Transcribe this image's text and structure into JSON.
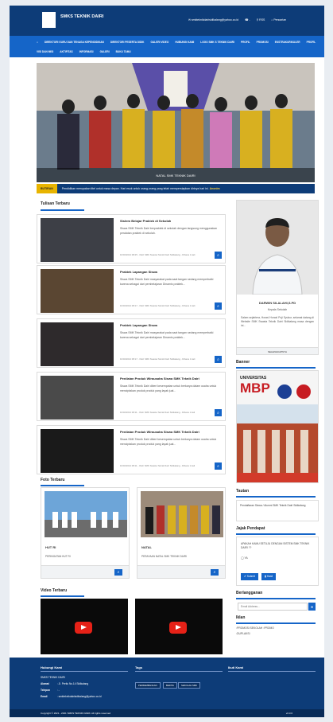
{
  "header": {
    "brand": "SMKS TEKNIK DAIRI",
    "email": "smkteknikdairisidikalang@yahoo.co.id",
    "phone": "-",
    "rss": "RSS",
    "search": "Pencarian"
  },
  "menu": [
    "BERANDA",
    "DIREKTORI GURU DAN TENAGA KEPENDIDIKAN",
    "DIREKTORI PESERTA DIDIK",
    "GALERI VIDEO",
    "HUBUNGI KAMI",
    "LOGO SMK S TEKNIK DAIRI",
    "PROFIL",
    "PROMOSI",
    "EKSTRAKURIKULER",
    "PROFIL",
    "VISI DAN MISI",
    "AKTIFITAS",
    "INFORMASI",
    "GALERI",
    "BUKU TAMU"
  ],
  "hero": {
    "caption": "NATAL SMK TEKNIK DAIRI"
  },
  "ticker": {
    "label": "BUTIRAN",
    "text": "Pendidikan merupakan titel untuk masa depan. Hari esok untuk orang-orang yang telah mempersiapkan dirinya hari ini.",
    "author": "Anonim"
  },
  "sections": {
    "posts_title": "Tulisan Terbaru",
    "photos_title": "Foto Terbaru",
    "videos_title": "Video Terbaru"
  },
  "posts": [
    {
      "title": "Sistem Belajar Praktek di Sekolah",
      "desc": "Siswa SMK Teknik Dairi berpraktek di sekolah dengan langsung menggunakan peralatan praktek di sekolah.",
      "meta": "10/02/2021 08:25 - Oleh SMK Swasta Teknik Dairi Sidikalang - Dibaca 1 kali"
    },
    {
      "title": "Praktek Lapangan Siswa",
      "desc": "Siswa SMK Teknik Dairi masyarakat pada saat tangan sedang memperbaiki karena sebagai dari pembelajaran Dinamis praktek...",
      "meta": "10/02/2021 08:17 - Oleh SMK Swasta Teknik Dairi Sidikalang - Dibaca 1 kali"
    },
    {
      "title": "Praktek Lapangan Siswa",
      "desc": "Siswa SMK Teknik Dairi masyarakat pada saat tangan sedang memperbaiki karena sebagai dari pembelajaran Dinamis praktek...",
      "meta": "10/02/2021 08:17 - Oleh SMK Swasta Teknik Dairi Sidikalang - Dibaca 1 kali"
    },
    {
      "title": "Penilaian Produk Wirausaha Siswa SMK Teknik Dairi",
      "desc": "Siswa SMK Teknik Dairi diberi kesempatan untuk berkarya dalam usaha untuk menciptakan produk produk yang layak jual...",
      "meta": "10/02/2021 08:11 - Oleh SMK Swasta Teknik Dairi Sidikalang - Dibaca 1 kali"
    },
    {
      "title": "Penilaian Produk Wirausaha Siswa SMK Teknik Dairi",
      "desc": "Siswa SMK Teknik Dairi diberi kesempatan untuk berkarya dalam usaha untuk menciptakan produk produk yang layak jual...",
      "meta": "10/02/2021 08:11 - Oleh SMK Swasta Teknik Dairi Sidikalang - Dibaca 1 kali"
    }
  ],
  "photos": [
    {
      "title": "HUT RI",
      "desc": "PERINGATAN HUT RI"
    },
    {
      "title": "NATAL",
      "desc": "PERAYAAN NATAL SMK TEKNIK DAIRI"
    }
  ],
  "sidebar": {
    "head_name": "DARWIN SILALAHI,S.PD",
    "head_role": "Kepala Sekolah",
    "head_text": "Salam sejahtera, Horas! Horas! Puji Syukur, selamat datang di Website SMK Swasta Teknik Dairi Sidikalang masa dengan ini...",
    "head_link": "SELENGKAPNYA",
    "banner_title": "Banner",
    "banner_big": "MBP",
    "banner_small": "UNIVERSITAS",
    "tautan_title": "Tautan",
    "tautan_link": "Pendaftaran Siswa / Alumni SMK Teknik Dairi Sidikalang",
    "poll_title": "Jajak Pendapat",
    "poll_q": "APAKAH KAMU SETUJU DENGAN SISTEM SMK TEKNIK DAIRI ??",
    "poll_opt": "YA",
    "vote_btn": "Submit",
    "result_btn": "Hasil",
    "subscribe_title": "Berlangganan",
    "subscribe_placeholder": "Email Address...",
    "ads_title": "Iklan",
    "ad1": "PROMOSI SEKOLAH",
    "ad2": "PROMO",
    "ad3": "DUPLAKSI"
  },
  "footer": {
    "contact_title": "Hubungi Kami",
    "tags_title": "Tags",
    "follow_title": "Ikuti Kami",
    "school": "SMKS TEKNIK DAIRI",
    "addr_lbl": "Alamat",
    "addr": "Jl. Pertiu No.14 Sidikalang",
    "tel_lbl": "Telepon",
    "tel": "-",
    "mail_lbl": "Email",
    "mail": "smkteknikdairisidikalang@yahoo.co.id",
    "tags": [
      "PERKEMBANGAN",
      "BERITA",
      "SEKOLAH SMK"
    ],
    "copyright": "Copyright © 2021 - 2021 SMKS TEKNIK DAIRI. All rights reserved",
    "version": "v2.3.0"
  }
}
